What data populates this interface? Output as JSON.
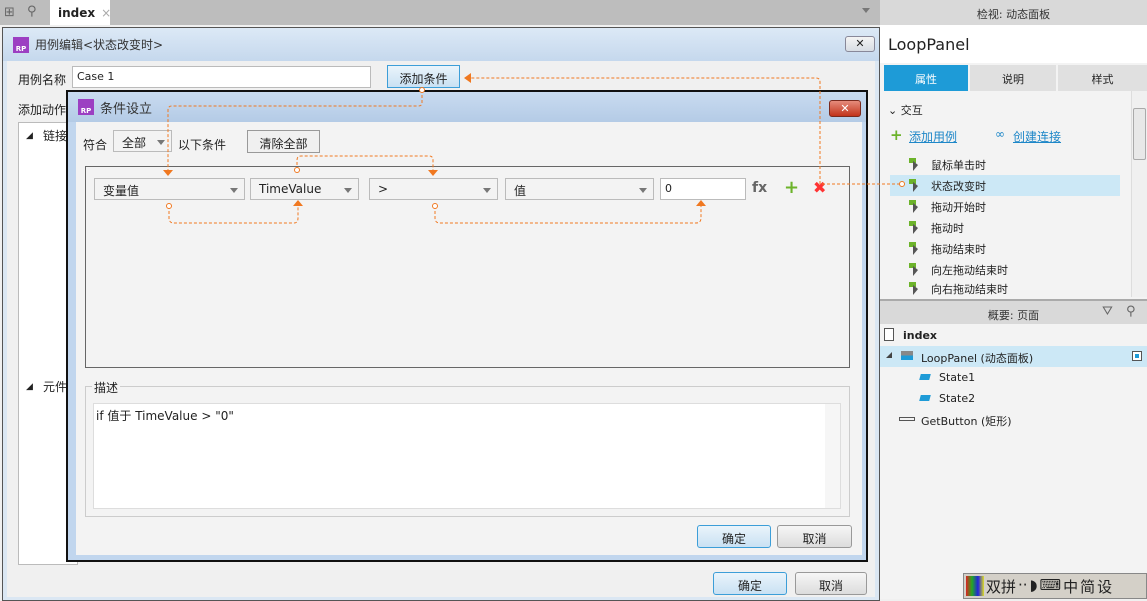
{
  "top": {
    "tab": "index",
    "close": "×"
  },
  "inspector": {
    "header": "检视: 动态面板",
    "name": "LoopPanel",
    "tabs": [
      "属性",
      "说明",
      "样式"
    ],
    "section": "交互",
    "add_case": "添加用例",
    "create_link": "创建连接",
    "events": [
      "鼠标单击时",
      "状态改变时",
      "拖动开始时",
      "拖动时",
      "拖动结束时",
      "向左拖动结束时",
      "向右拖动结束时"
    ]
  },
  "outline": {
    "header": "概要: 页面",
    "page": "index",
    "items": [
      "LoopPanel (动态面板)",
      "State1",
      "State2",
      "GetButton (矩形)"
    ]
  },
  "case_editor": {
    "title": "用例编辑<状态改变时>",
    "name_label": "用例名称",
    "name_value": "Case 1",
    "add_condition": "添加条件",
    "add_action": "添加动作",
    "tree": [
      "链接",
      "元件"
    ],
    "ok": "确定",
    "cancel": "取消"
  },
  "condition": {
    "title": "条件设立",
    "match_label": "符合",
    "match_value": "全部",
    "suffix": "以下条件",
    "clear_all": "清除全部",
    "row": {
      "type": "变量值",
      "variable": "TimeValue",
      "operator": ">",
      "value_type": "值",
      "value": "0",
      "fx": "fx"
    },
    "desc_label": "描述",
    "desc": "if 值于 TimeValue > \"0\"",
    "ok": "确定",
    "cancel": "取消"
  },
  "ime": [
    "双拼",
    "中",
    "简",
    "设"
  ],
  "colors": {
    "accent": "#1e9bd7",
    "connector": "#f07820",
    "selected": "#cce8f6"
  }
}
